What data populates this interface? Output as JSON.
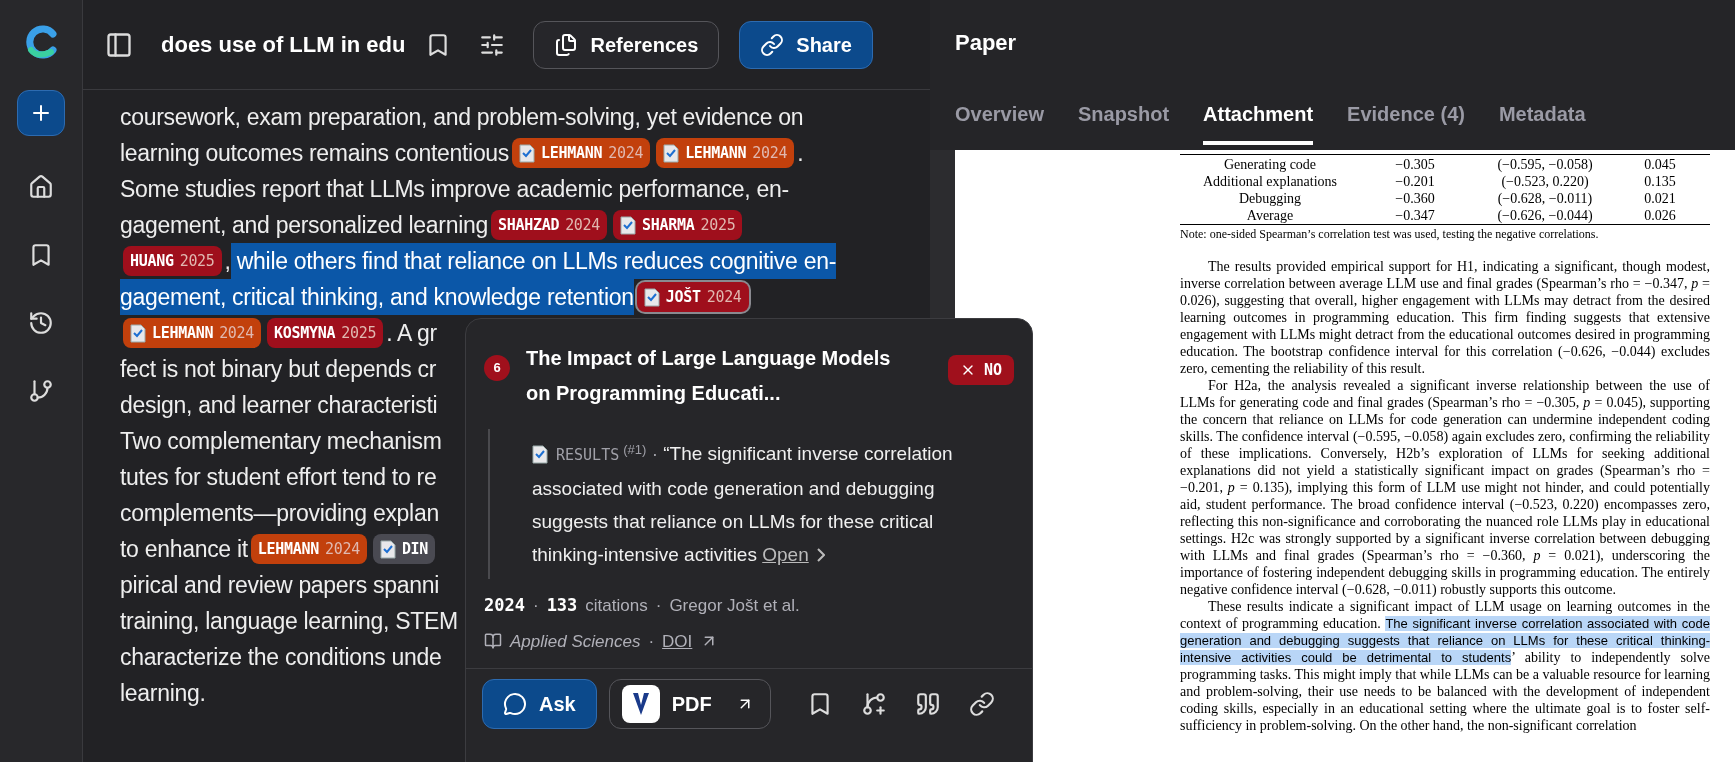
{
  "header": {
    "title": "does use of LLM in edu",
    "buttons": [
      {
        "label": "References",
        "primary": false
      },
      {
        "label": "Share",
        "primary": true
      }
    ]
  },
  "answer": {
    "lines": [
      [
        {
          "kind": "text",
          "text": "coursework, exam preparation, and problem-solving, yet evidence on",
          "highlighted": false
        }
      ],
      [
        {
          "kind": "text",
          "text": "learning outcomes remains contentious",
          "highlighted": false
        },
        {
          "kind": "cite",
          "author": "LEHMANN",
          "year": "2024",
          "color": "#c2400c",
          "attached": true,
          "hovered": false
        },
        {
          "kind": "cite",
          "author": "LEHMANN",
          "year": "2024",
          "color": "#c2400c",
          "attached": true,
          "hovered": false
        },
        {
          "kind": "text",
          "text": ".",
          "highlighted": false
        }
      ],
      [
        {
          "kind": "text",
          "text": "Some studies report that LLMs improve academic performance, en-",
          "highlighted": false
        }
      ],
      [
        {
          "kind": "text",
          "text": "gagement, and personalized learning",
          "highlighted": false
        },
        {
          "kind": "cite",
          "author": "SHAHZAD",
          "year": "2024",
          "color": "#9f0f1c",
          "attached": false,
          "hovered": false
        },
        {
          "kind": "cite",
          "author": "SHARMA",
          "year": "2025",
          "color": "#9f0f1c",
          "attached": true,
          "hovered": false
        }
      ],
      [
        {
          "kind": "cite",
          "author": "HUANG",
          "year": "2025",
          "color": "#9f0f1c",
          "attached": false,
          "hovered": false
        },
        {
          "kind": "text",
          "text": ",",
          "highlighted": false
        },
        {
          "kind": "text",
          "text": " while others find that reliance on LLMs reduces cognitive en-",
          "highlighted": true
        }
      ],
      [
        {
          "kind": "text",
          "text": "gagement, critical thinking, and knowledge retention",
          "highlighted": true
        },
        {
          "kind": "cite",
          "author": "JOŠT",
          "year": "2024",
          "color": "#9f0f1c",
          "attached": true,
          "hovered": true
        }
      ],
      [
        {
          "kind": "cite",
          "author": "LEHMANN",
          "year": "2024",
          "color": "#c2400c",
          "attached": true,
          "hovered": false
        },
        {
          "kind": "cite",
          "author": "KOSMYNA",
          "year": "2025",
          "color": "#9f0f1c",
          "attached": false,
          "hovered": false
        },
        {
          "kind": "text",
          "text": ". A gr",
          "highlighted": false
        }
      ],
      [
        {
          "kind": "text",
          "text": "fect is not binary but depends cr",
          "highlighted": false
        }
      ],
      [
        {
          "kind": "text",
          "text": "design, and learner characteristi",
          "highlighted": false
        }
      ],
      [
        {
          "kind": "text",
          "text": "Two complementary mechanism",
          "highlighted": false
        }
      ],
      [
        {
          "kind": "text",
          "text": "tutes for student effort tend to re",
          "highlighted": false
        }
      ],
      [
        {
          "kind": "text",
          "text": "complements—providing explan",
          "highlighted": false
        }
      ],
      [
        {
          "kind": "text",
          "text": "to enhance it",
          "highlighted": false
        },
        {
          "kind": "cite",
          "author": "LEHMANN",
          "year": "2024",
          "color": "#c2400c",
          "attached": false,
          "hovered": false
        },
        {
          "kind": "cite",
          "author": "DIN",
          "color": "#4a4a52",
          "attached": true,
          "hovered": false
        }
      ],
      [
        {
          "kind": "text",
          "text": "pirical and review papers spanni",
          "highlighted": false
        }
      ],
      [
        {
          "kind": "text",
          "text": "training, language learning, STEM",
          "highlighted": false
        }
      ],
      [
        {
          "kind": "text",
          "text": "characterize the conditions unde",
          "highlighted": false
        }
      ],
      [
        {
          "kind": "text",
          "text": "learning.",
          "highlighted": false
        }
      ]
    ]
  },
  "popup": {
    "number": "6",
    "title": "The Impact of Large Language Models on Programming Educati...",
    "verdict": "NO",
    "section": "RESULTS",
    "ref": "(#1)",
    "separator": "·",
    "quote": "“The significant inverse correlation associated with code generation and debugging suggests that reliance on LLMs for these critical thinking-intensive activities",
    "open": "Open",
    "year": "2024",
    "citations": "133",
    "citations_label": "citations",
    "authors": "Gregor Jošt et al.",
    "journal": "Applied Sciences",
    "doi": "DOI",
    "ask": "Ask",
    "pdf": "PDF"
  },
  "paper": {
    "title": "Paper",
    "tabs": [
      {
        "label": "Overview",
        "selected": false
      },
      {
        "label": "Snapshot",
        "selected": false
      },
      {
        "label": "Attachment",
        "selected": true
      },
      {
        "label": "Evidence (4)",
        "selected": false
      },
      {
        "label": "Metadata",
        "selected": false
      }
    ],
    "table": {
      "rows": [
        [
          "Generating code",
          "−0.305",
          "(−0.595, −0.058)",
          "0.045"
        ],
        [
          "Additional explanations",
          "−0.201",
          "(−0.523, 0.220)",
          "0.135"
        ],
        [
          "Debugging",
          "−0.360",
          "(−0.628, −0.011)",
          "0.021"
        ],
        [
          "Average",
          "−0.347",
          "(−0.626, −0.044)",
          "0.026"
        ]
      ]
    },
    "note": "Note: one-sided Spearman’s correlation test was used, testing the negative correlations.",
    "paragraphs": [
      [
        {
          "text": "The results provided empirical support for H1, indicating a significant, though modest, inverse correlation between average LLM use and final grades (Spearman’s rho = −0.347, *p* = 0.026), suggesting that overall, higher engagement with LLMs may detract from the desired learning outcomes in programming education.  This firm finding suggests that extensive engagement with LLMs might detract from the educational outcomes desired in programming education. The bootstrap confidence interval for this correlation (−0.626, −0.044) excludes zero, cementing the reliability of this result.",
          "highlighted": false
        }
      ],
      [
        {
          "text": "For H2a, the analysis revealed a significant inverse relationship between the use of LLMs for generating code and final grades (Spearman’s rho = −0.305, *p* = 0.045), supporting the concern that reliance on LLMs for code generation can undermine independent coding skills.  The confidence interval (−0.595, −0.058) again excludes zero, confirming the reliability of these implications.  Conversely, H2b’s exploration of LLMs for seeking additional explanations did not yield a statistically significant impact on grades (Spearman’s rho = −0.201, *p* = 0.135), implying this form of LLM use might not hinder, and could potentially aid, student performance. The broad confidence interval (−0.523, 0.220) encompasses zero, reflecting this non-significance and corroborating the nuanced role LLMs play in educational settings. H2c was strongly supported by a significant inverse correlation between debugging with LLMs and final grades (Spearman’s rho = −0.360, *p* = 0.021), underscoring the importance of fostering independent debugging skills in programming education. The entirely negative confidence interval (−0.628, −0.011) robustly supports this outcome.",
          "highlighted": false
        }
      ],
      [
        {
          "text": "These results indicate a significant impact of LLM usage on learning outcomes in the context of programming education. ",
          "highlighted": false
        },
        {
          "text": "The significant inverse correlation associated with code generation and debugging suggests that reliance on LLMs for these critical thinking-intensive activities could be detrimental to students",
          "highlighted": true
        },
        {
          "text": "’ ability to independently solve programming tasks. This might imply that while LLMs can be a valuable resource for learning and problem-solving, their use needs to be balanced with the development of independent coding skills, especially in an educational setting where the ultimate goal is to foster self-sufficiency in problem-solving. On the other hand, the non-significant correlation",
          "highlighted": false
        }
      ]
    ]
  }
}
